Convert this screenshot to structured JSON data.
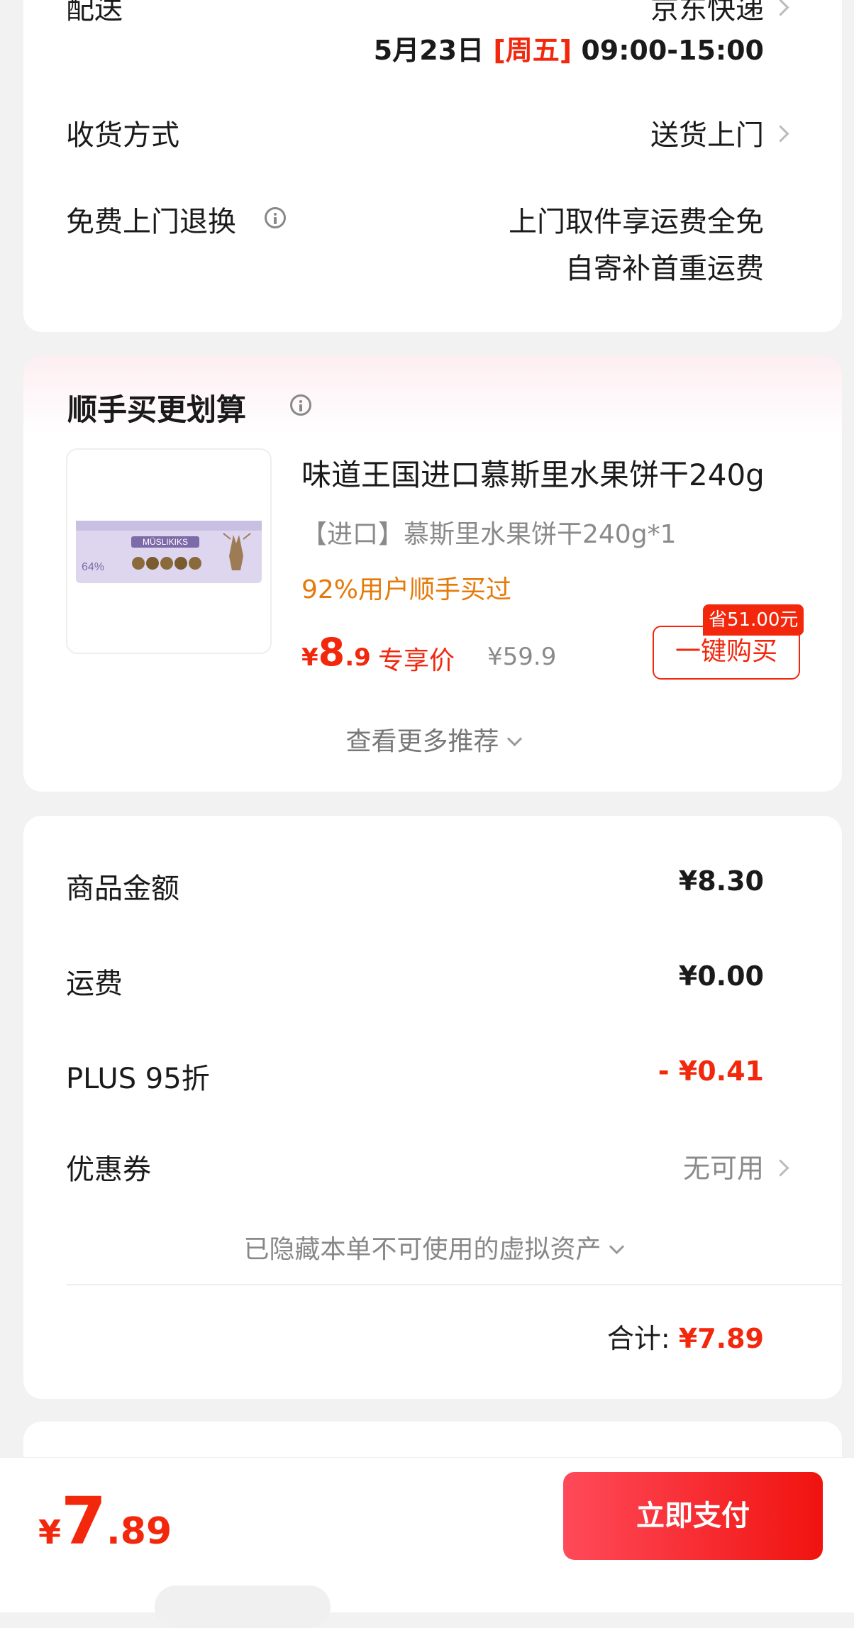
{
  "delivery": {
    "label": "配送",
    "carrier": "京东快递",
    "date": "5月23日",
    "weekday": "[周五]",
    "time": "09:00-15:00"
  },
  "receive": {
    "label": "收货方式",
    "value": "送货上门"
  },
  "return": {
    "label": "免费上门退换",
    "line1": "上门取件享运费全免",
    "line2": "自寄补首重运费"
  },
  "addon": {
    "title": "顺手买更划算",
    "product": {
      "name": "味道王国进口慕斯里水果饼干240g",
      "spec": "【进口】慕斯里水果饼干240g*1",
      "social": "92%用户顺手买过",
      "price_currency": "¥",
      "price_int": "8",
      "price_dec": ".9",
      "price_tag": "专享价",
      "original_price": "¥59.9",
      "save_badge": "省51.00元",
      "buy_label": "一键购买",
      "image_brand": "MÜSLIKIKS",
      "image_pct": "64%"
    },
    "more_label": "查看更多推荐"
  },
  "summary": {
    "rows": [
      {
        "label": "商品金额",
        "value": "¥8.30"
      },
      {
        "label": "运费",
        "value": "¥0.00"
      },
      {
        "label": "PLUS 95折",
        "value": "- ¥0.41"
      }
    ],
    "coupon_label": "优惠券",
    "coupon_value": "无可用",
    "hidden_note": "已隐藏本单不可使用的虚拟资产",
    "total_label": "合计:",
    "total_value": "¥7.89"
  },
  "footer": {
    "currency": "¥",
    "amount_int": "7",
    "amount_dec": ".89",
    "pay_label": "立即支付"
  },
  "colors": {
    "accent": "#f2270c",
    "orange": "#e47a0a",
    "pay_gradient_start": "#ff4a5a",
    "pay_gradient_end": "#f0130f"
  }
}
